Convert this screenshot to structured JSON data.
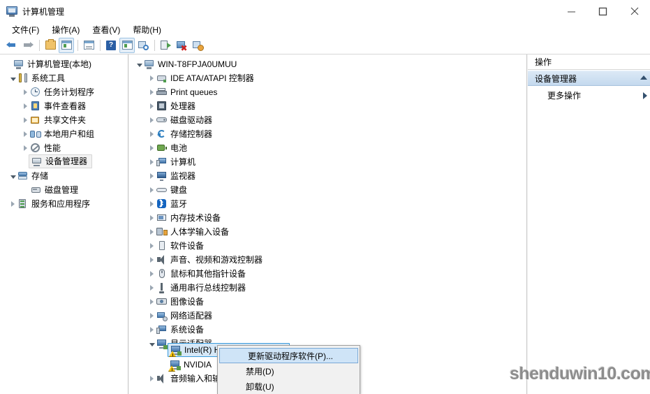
{
  "window": {
    "title": "计算机管理",
    "title_icon": "computer-management-icon",
    "minimize_label": "最小化",
    "maximize_label": "最大化",
    "close_label": "关闭"
  },
  "menubar": [
    {
      "label": "文件(F)"
    },
    {
      "label": "操作(A)"
    },
    {
      "label": "查看(V)"
    },
    {
      "label": "帮助(H)"
    }
  ],
  "toolbar": [
    {
      "name": "back-button",
      "icon": "back-arrow-icon"
    },
    {
      "name": "forward-button",
      "icon": "forward-arrow-icon"
    },
    {
      "name": "up-folder-button",
      "icon": "folder-up-icon"
    },
    {
      "name": "show-hide-tree-button",
      "icon": "console-tree-icon"
    },
    {
      "name": "properties-button",
      "icon": "properties-icon"
    },
    {
      "name": "help-button",
      "icon": "help-icon"
    },
    {
      "name": "show-pane-button",
      "icon": "show-pane-icon"
    },
    {
      "name": "scan-hardware-button",
      "icon": "scan-hardware-icon"
    },
    {
      "name": "update-driver-button",
      "icon": "update-driver-icon"
    },
    {
      "name": "disable-device-button",
      "icon": "disable-device-icon"
    },
    {
      "name": "uninstall-device-button",
      "icon": "uninstall-device-icon"
    }
  ],
  "console_tree": {
    "root": {
      "label": "计算机管理(本地)",
      "icon": "computer-management-icon"
    },
    "items": [
      {
        "label": "系统工具",
        "icon": "system-tools-icon",
        "depth": 1,
        "state": "expanded"
      },
      {
        "label": "任务计划程序",
        "icon": "task-scheduler-icon",
        "depth": 2,
        "state": "collapsed"
      },
      {
        "label": "事件查看器",
        "icon": "event-viewer-icon",
        "depth": 2,
        "state": "collapsed"
      },
      {
        "label": "共享文件夹",
        "icon": "shared-folders-icon",
        "depth": 2,
        "state": "collapsed"
      },
      {
        "label": "本地用户和组",
        "icon": "local-users-icon",
        "depth": 2,
        "state": "collapsed"
      },
      {
        "label": "性能",
        "icon": "performance-icon",
        "depth": 2,
        "state": "collapsed"
      },
      {
        "label": "设备管理器",
        "icon": "device-manager-icon",
        "depth": 2,
        "state": "leaf",
        "selected": true
      },
      {
        "label": "存储",
        "icon": "storage-icon",
        "depth": 1,
        "state": "expanded"
      },
      {
        "label": "磁盘管理",
        "icon": "disk-management-icon",
        "depth": 2,
        "state": "leaf"
      },
      {
        "label": "服务和应用程序",
        "icon": "services-apps-icon",
        "depth": 1,
        "state": "collapsed"
      }
    ]
  },
  "device_tree": {
    "root": {
      "label": "WIN-T8FPJA0UMUU",
      "icon": "computer-icon",
      "state": "expanded"
    },
    "items": [
      {
        "label": "IDE ATA/ATAPI 控制器",
        "icon": "ide-controller-icon",
        "state": "collapsed"
      },
      {
        "label": "Print queues",
        "icon": "print-queue-icon",
        "state": "collapsed"
      },
      {
        "label": "处理器",
        "icon": "processor-icon",
        "state": "collapsed"
      },
      {
        "label": "磁盘驱动器",
        "icon": "disk-drive-icon",
        "state": "collapsed"
      },
      {
        "label": "存储控制器",
        "icon": "storage-controller-icon",
        "state": "collapsed"
      },
      {
        "label": "电池",
        "icon": "battery-icon",
        "state": "collapsed"
      },
      {
        "label": "计算机",
        "icon": "computer-node-icon",
        "state": "collapsed"
      },
      {
        "label": "监视器",
        "icon": "monitor-icon",
        "state": "collapsed"
      },
      {
        "label": "键盘",
        "icon": "keyboard-icon",
        "state": "collapsed"
      },
      {
        "label": "蓝牙",
        "icon": "bluetooth-icon",
        "state": "collapsed"
      },
      {
        "label": "内存技术设备",
        "icon": "memory-device-icon",
        "state": "collapsed"
      },
      {
        "label": "人体学输入设备",
        "icon": "hid-icon",
        "state": "collapsed"
      },
      {
        "label": "软件设备",
        "icon": "software-device-icon",
        "state": "collapsed"
      },
      {
        "label": "声音、视频和游戏控制器",
        "icon": "sound-video-icon",
        "state": "collapsed"
      },
      {
        "label": "鼠标和其他指针设备",
        "icon": "mouse-icon",
        "state": "collapsed"
      },
      {
        "label": "通用串行总线控制器",
        "icon": "usb-controller-icon",
        "state": "collapsed"
      },
      {
        "label": "图像设备",
        "icon": "imaging-device-icon",
        "state": "collapsed"
      },
      {
        "label": "网络适配器",
        "icon": "network-adapter-icon",
        "state": "collapsed"
      },
      {
        "label": "系统设备",
        "icon": "system-device-icon",
        "state": "collapsed"
      },
      {
        "label": "显示适配器",
        "icon": "display-adapter-icon",
        "state": "expanded"
      }
    ],
    "display_children": [
      {
        "label": "Intel(R) HD Graphics 4600",
        "icon": "display-adapter-icon",
        "warning": true,
        "selected": true
      },
      {
        "label": "NVIDIA",
        "icon": "display-adapter-icon",
        "warning": true,
        "selected": false
      }
    ],
    "trailing": [
      {
        "label": "音频输入和输出",
        "icon": "audio-io-icon",
        "state": "collapsed"
      }
    ]
  },
  "actions_panel": {
    "header": "操作",
    "section": "设备管理器",
    "more_actions": "更多操作"
  },
  "context_menu": {
    "items": [
      {
        "label": "更新驱动程序软件(P)...",
        "highlighted": true
      },
      {
        "label": "禁用(D)",
        "highlighted": false
      },
      {
        "label": "卸载(U)",
        "highlighted": false
      }
    ]
  },
  "watermark": {
    "text": "shenduwin10.com"
  },
  "colors": {
    "selection_blue": "#d6e8f7",
    "selection_border": "#3a9bdc",
    "actions_header": "#dce9f6",
    "warning_yellow": "#f2c010"
  }
}
